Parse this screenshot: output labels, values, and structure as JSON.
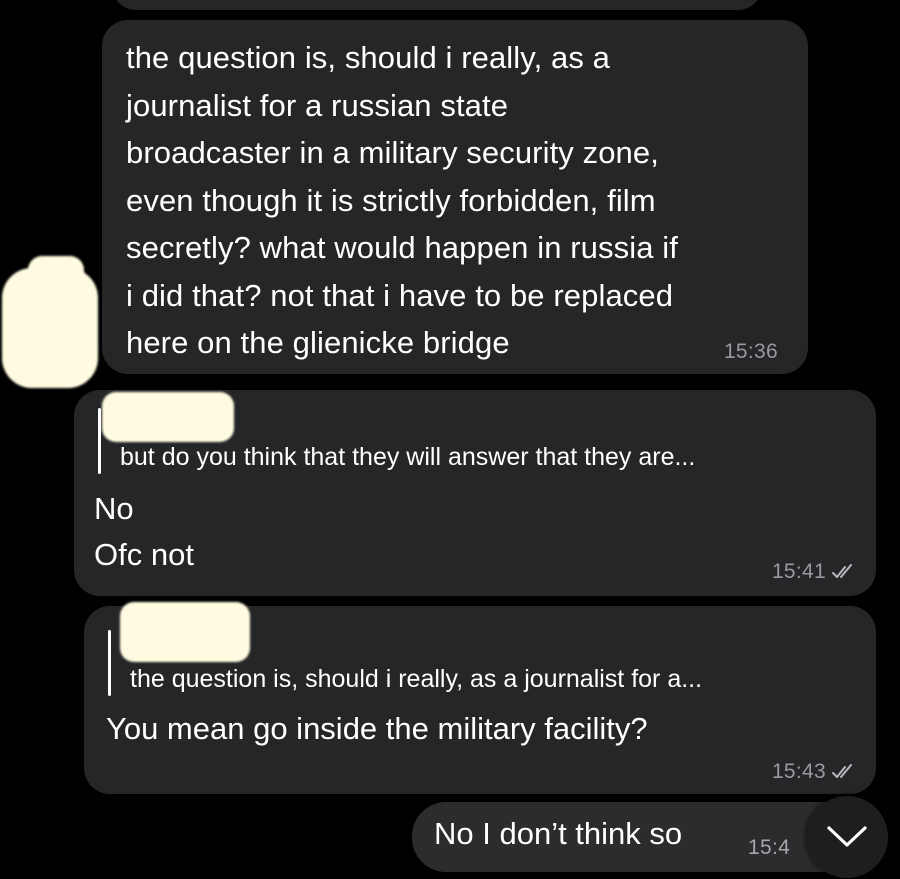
{
  "messages": [
    {
      "direction": "incoming",
      "text": "the question is, should i really, as a\njournalist for a russian state\nbroadcaster in a military security zone,\neven though it is strictly forbidden, film\nsecretly? what would happen in russia if\ni did that? not that i have to be replaced\nhere on the glienicke bridge",
      "time": "15:36"
    },
    {
      "direction": "outgoing",
      "reply_preview": "but do you think that they will answer that they are...",
      "text": "No\nOfc not",
      "time": "15:41",
      "status": "read"
    },
    {
      "direction": "outgoing",
      "reply_preview": "the question is, should i really, as a journalist for a...",
      "text": "You mean go inside the military facility?",
      "time": "15:43",
      "status": "read"
    },
    {
      "direction": "outgoing",
      "text": "No I don’t think so",
      "time": "15:4"
    }
  ],
  "icons": {
    "read_status": "double-check-icon",
    "scroll_down": "chevron-down-icon"
  },
  "colors": {
    "background": "#000000",
    "bubble": "#262628",
    "timestamp": "#9a9a9e",
    "redaction": "#fffbe0"
  }
}
